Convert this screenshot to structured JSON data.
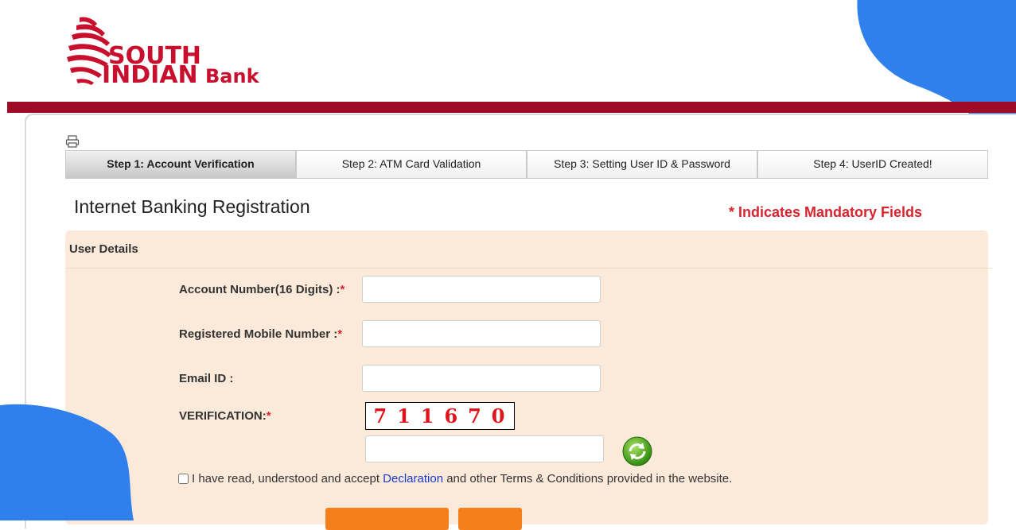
{
  "logo": {
    "line1": "SOUTH",
    "line2": "INDIAN",
    "word": "Bank"
  },
  "steps": [
    {
      "label": "Step 1: Account Verification",
      "active": true
    },
    {
      "label": "Step 2: ATM Card Validation",
      "active": false
    },
    {
      "label": "Step 3: Setting User ID & Password",
      "active": false
    },
    {
      "label": "Step 4: UserID Created!",
      "active": false
    }
  ],
  "page_title": "Internet Banking Registration",
  "mandatory_note": "* Indicates Mandatory Fields",
  "section_title": "User Details",
  "fields": {
    "account": {
      "label": "Account Number(16 Digits) :",
      "required_mark": "*",
      "value": ""
    },
    "mobile": {
      "label": "Registered Mobile Number :",
      "required_mark": "*",
      "value": ""
    },
    "email": {
      "label": "Email ID :",
      "value": ""
    },
    "verification": {
      "label": "VERIFICATION:",
      "required_mark": "*",
      "value": ""
    }
  },
  "captcha": {
    "chars": [
      "7",
      "1",
      "1",
      "6",
      "7",
      "0"
    ]
  },
  "consent": {
    "before": "I have read, understood and accept ",
    "link": "Declaration",
    "after": " and other Terms & Conditions provided in the website."
  },
  "buttons": {
    "partial_1": "",
    "partial_2": ""
  },
  "colors": {
    "brand_red": "#9d0b26",
    "accent_orange": "#f57f1a",
    "form_bg": "#fbe9da",
    "blob_blue": "#2f80ed",
    "required_red": "#d9232d"
  }
}
